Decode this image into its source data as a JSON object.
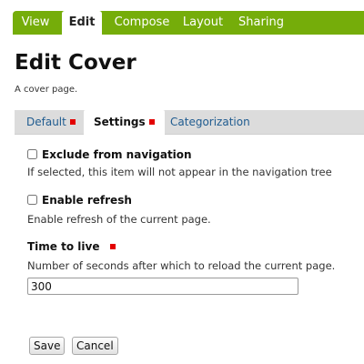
{
  "top_tabs": [
    {
      "label": "View",
      "active": false
    },
    {
      "label": "Edit",
      "active": true
    },
    {
      "label": "Compose",
      "active": false
    },
    {
      "label": "Layout",
      "active": false
    },
    {
      "label": "Sharing",
      "active": false
    }
  ],
  "page": {
    "title": "Edit Cover",
    "description": "A cover page."
  },
  "sub_tabs": [
    {
      "label": "Default",
      "required": true,
      "active": false
    },
    {
      "label": "Settings",
      "required": true,
      "active": true
    },
    {
      "label": "Categorization",
      "required": false,
      "active": false
    }
  ],
  "fields": {
    "exclude_nav": {
      "label": "Exclude from navigation",
      "help": "If selected, this item will not appear in the navigation tree",
      "checked": false
    },
    "enable_refresh": {
      "label": "Enable refresh",
      "help": "Enable refresh of the current page.",
      "checked": false
    },
    "time_to_live": {
      "label": "Time to live",
      "help": "Number of seconds after which to reload the current page.",
      "value": "300",
      "required": true
    }
  },
  "buttons": {
    "save": "Save",
    "cancel": "Cancel"
  },
  "colors": {
    "tabbar_green": "#75ad0a",
    "required_red": "#e30000",
    "link_blue": "#205c90"
  }
}
